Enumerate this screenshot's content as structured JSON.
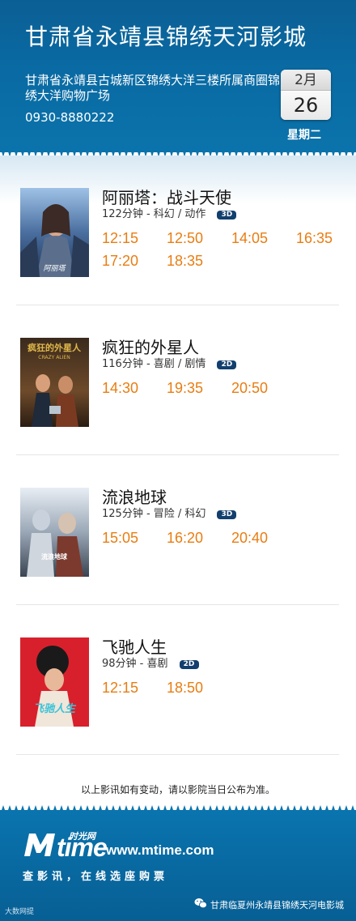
{
  "header": {
    "title": "甘肃省永靖县锦绣天河影城",
    "address": "甘肃省永靖县古城新区锦绣大洋三楼所属商圈锦绣大洋购物广场",
    "phone": "0930-8880222",
    "date_month": "2月",
    "date_day": "26",
    "weekday": "星期二"
  },
  "movies": [
    {
      "title": "阿丽塔：战斗天使",
      "info": "122分钟 - 科幻 / 动作",
      "format": "3D",
      "times": [
        "12:15",
        "12:50",
        "14:05",
        "16:35",
        "17:20",
        "18:35"
      ]
    },
    {
      "title": "疯狂的外星人",
      "info": "116分钟 - 喜剧 / 剧情",
      "format": "2D",
      "times": [
        "14:30",
        "19:35",
        "20:50"
      ]
    },
    {
      "title": "流浪地球",
      "info": "125分钟 - 冒险 / 科幻",
      "format": "3D",
      "times": [
        "15:05",
        "16:20",
        "20:40"
      ]
    },
    {
      "title": "飞驰人生",
      "info": "98分钟 - 喜剧",
      "format": "2D",
      "times": [
        "12:15",
        "18:50"
      ]
    }
  ],
  "notice": "以上影讯如有变动，请以影院当日公布为准。",
  "footer": {
    "logo_cn": "时光网",
    "logo_text": "time",
    "url": "www.mtime.com",
    "slogan": "查影讯，在线选座购票",
    "wechat_name": "甘肃临夏州永靖县锦绣天河电影城",
    "corner_mark": "大数网提"
  },
  "colors": {
    "header_blue": "#0a6aa3",
    "showtime_orange": "#e87d12",
    "format_badge": "#123f6e"
  }
}
